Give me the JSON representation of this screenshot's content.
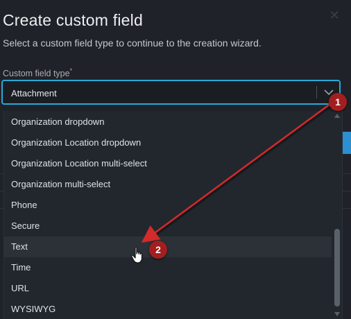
{
  "dialog": {
    "title": "Create custom field",
    "close_icon": "close-icon",
    "subtitle": "Select a custom field type to continue to the creation wizard.",
    "field_label": "Custom field type",
    "required_marker": "*",
    "selected_value": "Attachment",
    "chevron_icon": "chevron-down-icon"
  },
  "dropdown": {
    "options": [
      "Organization dropdown",
      "Organization Location dropdown",
      "Organization Location multi-select",
      "Organization multi-select",
      "Phone",
      "Secure",
      "Text",
      "Time",
      "URL",
      "WYSIWYG"
    ],
    "highlighted": "Text"
  },
  "annotations": {
    "step1": "1",
    "step2": "2",
    "color": "#a31f1f"
  },
  "colors": {
    "accent": "#2aa8d8",
    "background": "#1f2329",
    "arrow": "#d42a2a"
  }
}
